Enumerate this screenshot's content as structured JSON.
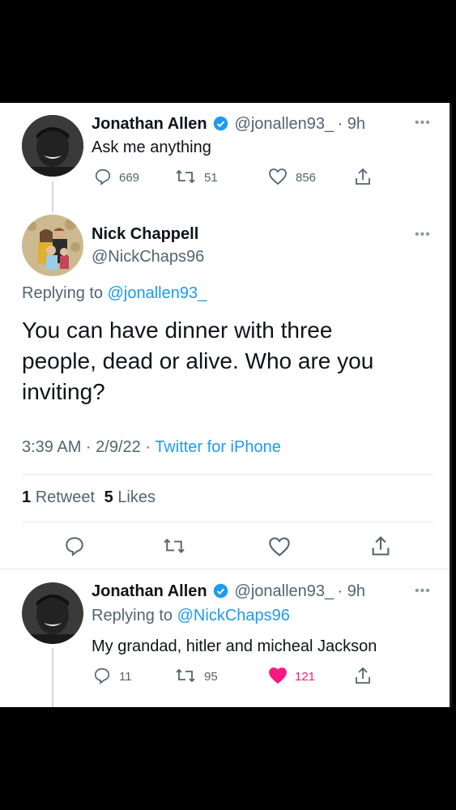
{
  "tweet1": {
    "name": "Jonathan Allen",
    "handle": "@jonallen93_",
    "time": "· 9h",
    "text": "Ask me anything",
    "replies": "669",
    "retweets": "51",
    "likes": "856"
  },
  "tweet2": {
    "name": "Nick Chappell",
    "handle": "@NickChaps96",
    "replying_prefix": "Replying to",
    "replying_to": "@jonallen93_",
    "text_line1": "You can have dinner with three",
    "text_line2": "people, dead or alive. Who are you",
    "text_line3": "inviting?",
    "meta_time": "3:39 AM · 2/9/22 ·",
    "meta_source": "Twitter for iPhone",
    "retweet_count": "1",
    "retweet_label": "Retweet",
    "like_count": "5",
    "like_label": "Likes"
  },
  "tweet3": {
    "name": "Jonathan Allen",
    "handle": "@jonallen93_",
    "time": "· 9h",
    "replying_prefix": "Replying to",
    "replying_to": "@NickChaps96",
    "text": "My grandad, hitler and micheal Jackson",
    "replies": "11",
    "retweets": "95",
    "likes": "121"
  },
  "colors": {
    "link": "#1d9bf0",
    "verified": "#1d9bf0",
    "liked": "#f91880",
    "muted": "#536471"
  },
  "icons": [
    "verified-badge-icon",
    "reply-icon",
    "retweet-icon",
    "like-icon",
    "share-icon",
    "more-icon"
  ]
}
